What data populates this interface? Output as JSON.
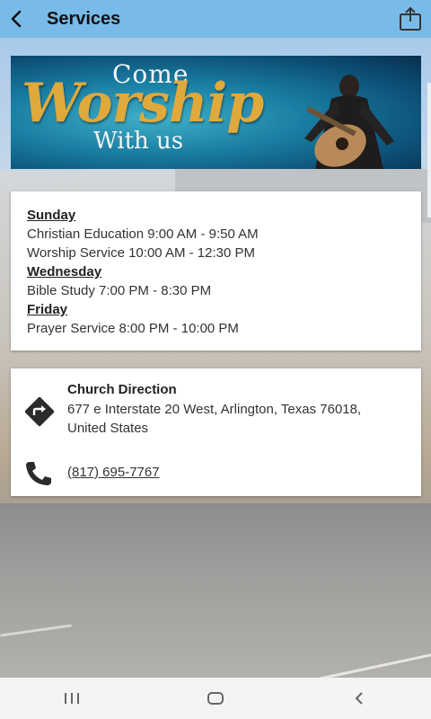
{
  "header": {
    "title": "Services"
  },
  "banner": {
    "line1": "Come",
    "line2": "Worship",
    "line3": "With us"
  },
  "schedule": [
    {
      "day": "Sunday",
      "services": [
        "Christian Education 9:00 AM - 9:50 AM",
        "Worship Service 10:00 AM - 12:30 PM"
      ]
    },
    {
      "day": "Wednesday",
      "services": [
        "Bible Study 7:00 PM - 8:30 PM"
      ]
    },
    {
      "day": "Friday ",
      "services": [
        "Prayer Service 8:00 PM - 10:00 PM"
      ]
    }
  ],
  "contact": {
    "direction_title": "Church Direction",
    "address": "677 e Interstate 20 West, Arlington, Texas 76018, United States",
    "phone": "(817) 695-7767"
  },
  "colors": {
    "header_bg": "#79bbe8",
    "banner_gold": "#e0a93b",
    "icon_dark": "#2b2b2b"
  },
  "icons": {
    "back": "arrow-back-icon",
    "share": "share-icon",
    "direction": "direction-icon",
    "phone": "phone-icon",
    "recents": "recents-icon",
    "home": "home-icon",
    "nav_back": "nav-back-icon"
  }
}
